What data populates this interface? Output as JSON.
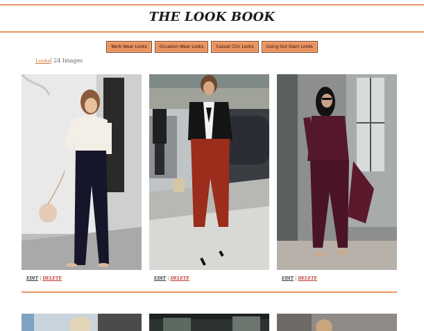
{
  "header": {
    "title": "THE LOOK BOOK"
  },
  "nav": {
    "items": [
      "Work Wear Looks",
      "Occasion Wear Looks",
      "Casual Chic Looks",
      "Going Out Glam Looks"
    ]
  },
  "breadcrumb": {
    "link": "Looks",
    "separator": "|",
    "count_text": "24 Images"
  },
  "cards": [
    {
      "edit": "EDIT",
      "sep": "|",
      "delete": "DELETE"
    },
    {
      "edit": "EDIT",
      "sep": "|",
      "delete": "DELETE"
    },
    {
      "edit": "EDIT",
      "sep": "|",
      "delete": "DELETE"
    }
  ],
  "colors": {
    "accent": "#e8935f",
    "accent_border": "#7a3b1a",
    "delete": "#c0392b"
  }
}
